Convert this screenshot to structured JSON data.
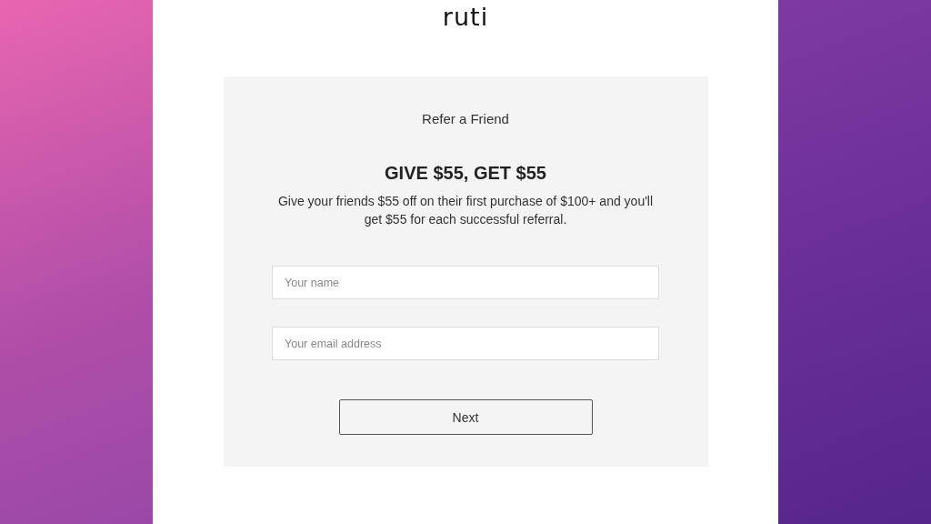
{
  "logo": "ruti",
  "card": {
    "title": "Refer a Friend",
    "heading": "GIVE $55, GET $55",
    "description": "Give your friends $55 off on their first purchase of $100+ and you'll get $55 for each successful referral.",
    "fields": [
      {
        "placeholder": "Your name"
      },
      {
        "placeholder": "Your email address"
      }
    ],
    "button": "Next"
  }
}
